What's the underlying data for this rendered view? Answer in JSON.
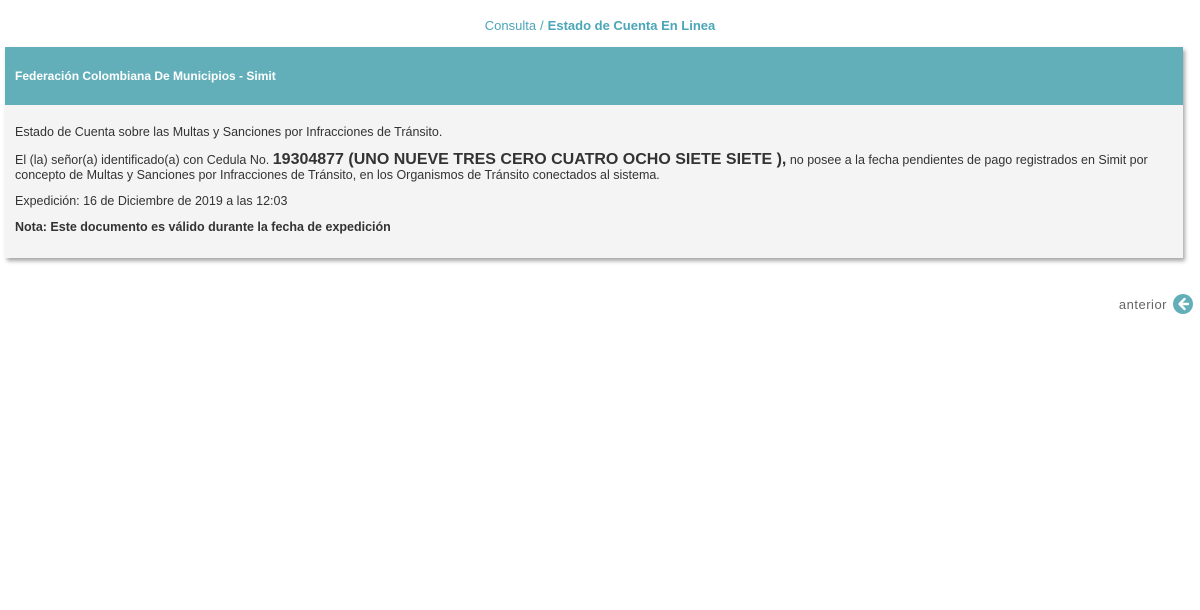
{
  "breadcrumb": {
    "parent": "Consulta",
    "separator": "/",
    "current": "Estado de Cuenta En Linea"
  },
  "panel": {
    "title": "Federación Colombiana De Municipios - Simit",
    "intro": "Estado de Cuenta sobre las Multas y Sanciones por Infracciones de Tránsito.",
    "body_prefix": "El (la) señor(a) identificado(a) con Cedula No. ",
    "id_number": "19304877 (UNO NUEVE TRES CERO CUATRO OCHO SIETE SIETE ),",
    "body_suffix": " no posee a la fecha pendientes de pago registrados en Simit por concepto de Multas y Sanciones por Infracciones de Tránsito, en los Organismos de Tránsito conectados al sistema.",
    "issued": "Expedición: 16 de Diciembre de 2019 a las 12:03",
    "note": "Nota: Este documento es válido durante la fecha de expedición"
  },
  "nav": {
    "back_label": "anterior",
    "back_icon": "arrow-left-circle-icon"
  },
  "colors": {
    "accent": "#62afb9",
    "link": "#4aa6b8",
    "panel_bg": "#f4f4f4"
  }
}
